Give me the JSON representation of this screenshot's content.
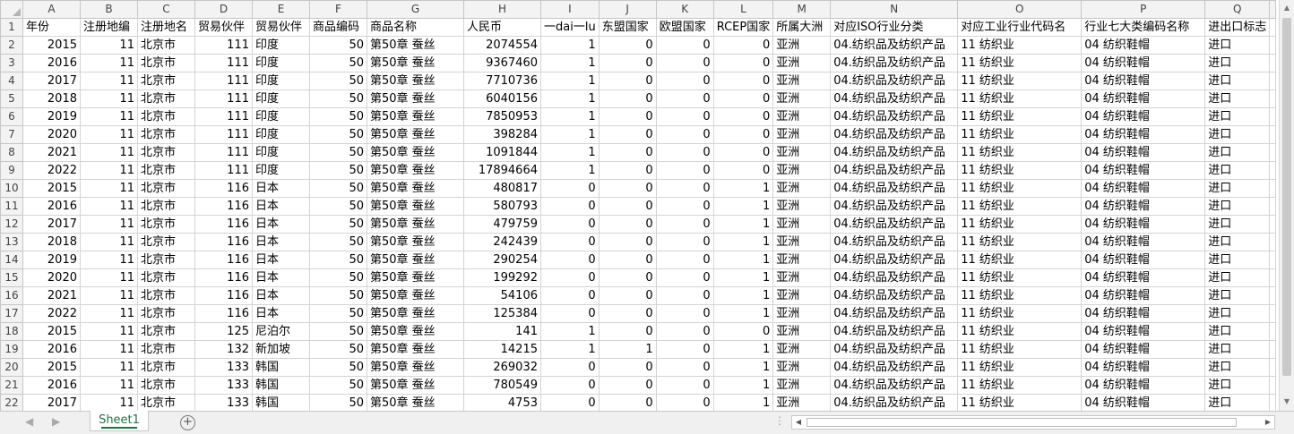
{
  "columns": [
    "A",
    "B",
    "C",
    "D",
    "E",
    "F",
    "G",
    "H",
    "I",
    "J",
    "K",
    "L",
    "M",
    "N",
    "O",
    "P",
    "Q"
  ],
  "headers": [
    "年份",
    "注册地编",
    "注册地名",
    "贸易伙伴",
    "贸易伙伴",
    "商品编码",
    "商品名称",
    "人民币",
    "一dai一lu",
    "东盟国家",
    "欧盟国家",
    "RCEP国家",
    "所属大洲",
    "对应ISO行业分类",
    "对应工业行业代码名",
    "行业七大类编码名称",
    "进出口标志"
  ],
  "rows": [
    [
      "2015",
      "11",
      "北京市",
      "111",
      "印度",
      "50",
      "第50章 蚕丝",
      "2074554",
      "1",
      "0",
      "0",
      "0",
      "亚洲",
      "04.纺织品及纺织产品",
      "11 纺织业",
      "04 纺织鞋帽",
      "进口"
    ],
    [
      "2016",
      "11",
      "北京市",
      "111",
      "印度",
      "50",
      "第50章 蚕丝",
      "9367460",
      "1",
      "0",
      "0",
      "0",
      "亚洲",
      "04.纺织品及纺织产品",
      "11 纺织业",
      "04 纺织鞋帽",
      "进口"
    ],
    [
      "2017",
      "11",
      "北京市",
      "111",
      "印度",
      "50",
      "第50章 蚕丝",
      "7710736",
      "1",
      "0",
      "0",
      "0",
      "亚洲",
      "04.纺织品及纺织产品",
      "11 纺织业",
      "04 纺织鞋帽",
      "进口"
    ],
    [
      "2018",
      "11",
      "北京市",
      "111",
      "印度",
      "50",
      "第50章 蚕丝",
      "6040156",
      "1",
      "0",
      "0",
      "0",
      "亚洲",
      "04.纺织品及纺织产品",
      "11 纺织业",
      "04 纺织鞋帽",
      "进口"
    ],
    [
      "2019",
      "11",
      "北京市",
      "111",
      "印度",
      "50",
      "第50章 蚕丝",
      "7850953",
      "1",
      "0",
      "0",
      "0",
      "亚洲",
      "04.纺织品及纺织产品",
      "11 纺织业",
      "04 纺织鞋帽",
      "进口"
    ],
    [
      "2020",
      "11",
      "北京市",
      "111",
      "印度",
      "50",
      "第50章 蚕丝",
      "398284",
      "1",
      "0",
      "0",
      "0",
      "亚洲",
      "04.纺织品及纺织产品",
      "11 纺织业",
      "04 纺织鞋帽",
      "进口"
    ],
    [
      "2021",
      "11",
      "北京市",
      "111",
      "印度",
      "50",
      "第50章 蚕丝",
      "1091844",
      "1",
      "0",
      "0",
      "0",
      "亚洲",
      "04.纺织品及纺织产品",
      "11 纺织业",
      "04 纺织鞋帽",
      "进口"
    ],
    [
      "2022",
      "11",
      "北京市",
      "111",
      "印度",
      "50",
      "第50章 蚕丝",
      "17894664",
      "1",
      "0",
      "0",
      "0",
      "亚洲",
      "04.纺织品及纺织产品",
      "11 纺织业",
      "04 纺织鞋帽",
      "进口"
    ],
    [
      "2015",
      "11",
      "北京市",
      "116",
      "日本",
      "50",
      "第50章 蚕丝",
      "480817",
      "0",
      "0",
      "0",
      "1",
      "亚洲",
      "04.纺织品及纺织产品",
      "11 纺织业",
      "04 纺织鞋帽",
      "进口"
    ],
    [
      "2016",
      "11",
      "北京市",
      "116",
      "日本",
      "50",
      "第50章 蚕丝",
      "580793",
      "0",
      "0",
      "0",
      "1",
      "亚洲",
      "04.纺织品及纺织产品",
      "11 纺织业",
      "04 纺织鞋帽",
      "进口"
    ],
    [
      "2017",
      "11",
      "北京市",
      "116",
      "日本",
      "50",
      "第50章 蚕丝",
      "479759",
      "0",
      "0",
      "0",
      "1",
      "亚洲",
      "04.纺织品及纺织产品",
      "11 纺织业",
      "04 纺织鞋帽",
      "进口"
    ],
    [
      "2018",
      "11",
      "北京市",
      "116",
      "日本",
      "50",
      "第50章 蚕丝",
      "242439",
      "0",
      "0",
      "0",
      "1",
      "亚洲",
      "04.纺织品及纺织产品",
      "11 纺织业",
      "04 纺织鞋帽",
      "进口"
    ],
    [
      "2019",
      "11",
      "北京市",
      "116",
      "日本",
      "50",
      "第50章 蚕丝",
      "290254",
      "0",
      "0",
      "0",
      "1",
      "亚洲",
      "04.纺织品及纺织产品",
      "11 纺织业",
      "04 纺织鞋帽",
      "进口"
    ],
    [
      "2020",
      "11",
      "北京市",
      "116",
      "日本",
      "50",
      "第50章 蚕丝",
      "199292",
      "0",
      "0",
      "0",
      "1",
      "亚洲",
      "04.纺织品及纺织产品",
      "11 纺织业",
      "04 纺织鞋帽",
      "进口"
    ],
    [
      "2021",
      "11",
      "北京市",
      "116",
      "日本",
      "50",
      "第50章 蚕丝",
      "54106",
      "0",
      "0",
      "0",
      "1",
      "亚洲",
      "04.纺织品及纺织产品",
      "11 纺织业",
      "04 纺织鞋帽",
      "进口"
    ],
    [
      "2022",
      "11",
      "北京市",
      "116",
      "日本",
      "50",
      "第50章 蚕丝",
      "125384",
      "0",
      "0",
      "0",
      "1",
      "亚洲",
      "04.纺织品及纺织产品",
      "11 纺织业",
      "04 纺织鞋帽",
      "进口"
    ],
    [
      "2015",
      "11",
      "北京市",
      "125",
      "尼泊尔",
      "50",
      "第50章 蚕丝",
      "141",
      "1",
      "0",
      "0",
      "0",
      "亚洲",
      "04.纺织品及纺织产品",
      "11 纺织业",
      "04 纺织鞋帽",
      "进口"
    ],
    [
      "2016",
      "11",
      "北京市",
      "132",
      "新加坡",
      "50",
      "第50章 蚕丝",
      "14215",
      "1",
      "1",
      "0",
      "1",
      "亚洲",
      "04.纺织品及纺织产品",
      "11 纺织业",
      "04 纺织鞋帽",
      "进口"
    ],
    [
      "2015",
      "11",
      "北京市",
      "133",
      "韩国",
      "50",
      "第50章 蚕丝",
      "269032",
      "0",
      "0",
      "0",
      "1",
      "亚洲",
      "04.纺织品及纺织产品",
      "11 纺织业",
      "04 纺织鞋帽",
      "进口"
    ],
    [
      "2016",
      "11",
      "北京市",
      "133",
      "韩国",
      "50",
      "第50章 蚕丝",
      "780549",
      "0",
      "0",
      "0",
      "1",
      "亚洲",
      "04.纺织品及纺织产品",
      "11 纺织业",
      "04 纺织鞋帽",
      "进口"
    ],
    [
      "2017",
      "11",
      "北京市",
      "133",
      "韩国",
      "50",
      "第50章 蚕丝",
      "4753",
      "0",
      "0",
      "0",
      "1",
      "亚洲",
      "04.纺织品及纺织产品",
      "11 纺织业",
      "04 纺织鞋帽",
      "进口"
    ]
  ],
  "numeric_columns": [
    0,
    1,
    3,
    5,
    7,
    8,
    9,
    10,
    11
  ],
  "sheet_tab": "Sheet1",
  "add_sheet_symbol": "+",
  "hscroll_dots": "⋮",
  "accent_color": "#217346"
}
